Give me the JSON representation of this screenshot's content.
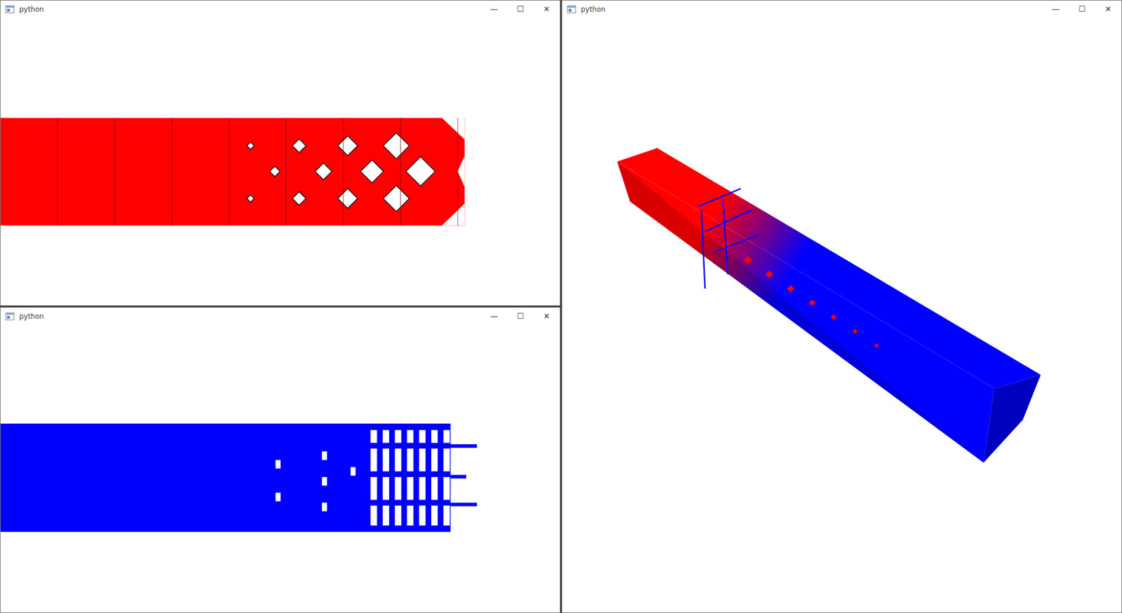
{
  "windows": [
    {
      "title": "python",
      "controls": [
        "—",
        "☐",
        "✕"
      ],
      "kind": "lattice",
      "colors": [
        "#ff0000"
      ]
    },
    {
      "title": "python",
      "controls": [
        "—",
        "☐",
        "✕"
      ],
      "kind": "struts",
      "colors": [
        "#0000ff"
      ]
    },
    {
      "title": "python",
      "controls": [
        "—",
        "☐",
        "✕"
      ],
      "kind": "beam",
      "colors": [
        "#ff0000",
        "#0000ff"
      ]
    }
  ]
}
